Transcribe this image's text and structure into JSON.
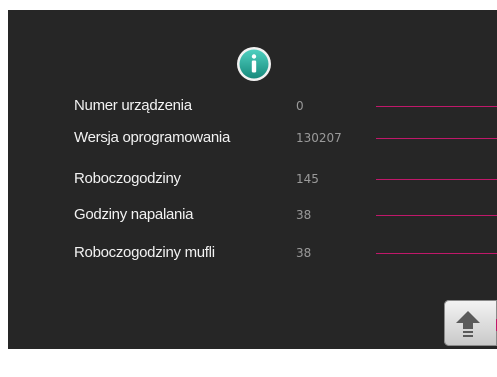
{
  "header": {
    "icon": "info-icon",
    "accent_color": "#2aa89a"
  },
  "info_rows": [
    {
      "label": "Numer urządzenia",
      "value": "0"
    },
    {
      "label": "Wersja oprogramowania",
      "value": "130207"
    },
    {
      "label": "Roboczogodziny",
      "value": "145"
    },
    {
      "label": "Godziny napalania",
      "value": "38"
    },
    {
      "label": "Roboczogodziny mufli",
      "value": "38"
    }
  ],
  "footer": {
    "up_button_icon": "up-arrow-icon"
  },
  "colors": {
    "background": "#262626",
    "label_text": "#f2f2f2",
    "value_text": "#9a9a9a",
    "row_line": "#c0186a"
  }
}
